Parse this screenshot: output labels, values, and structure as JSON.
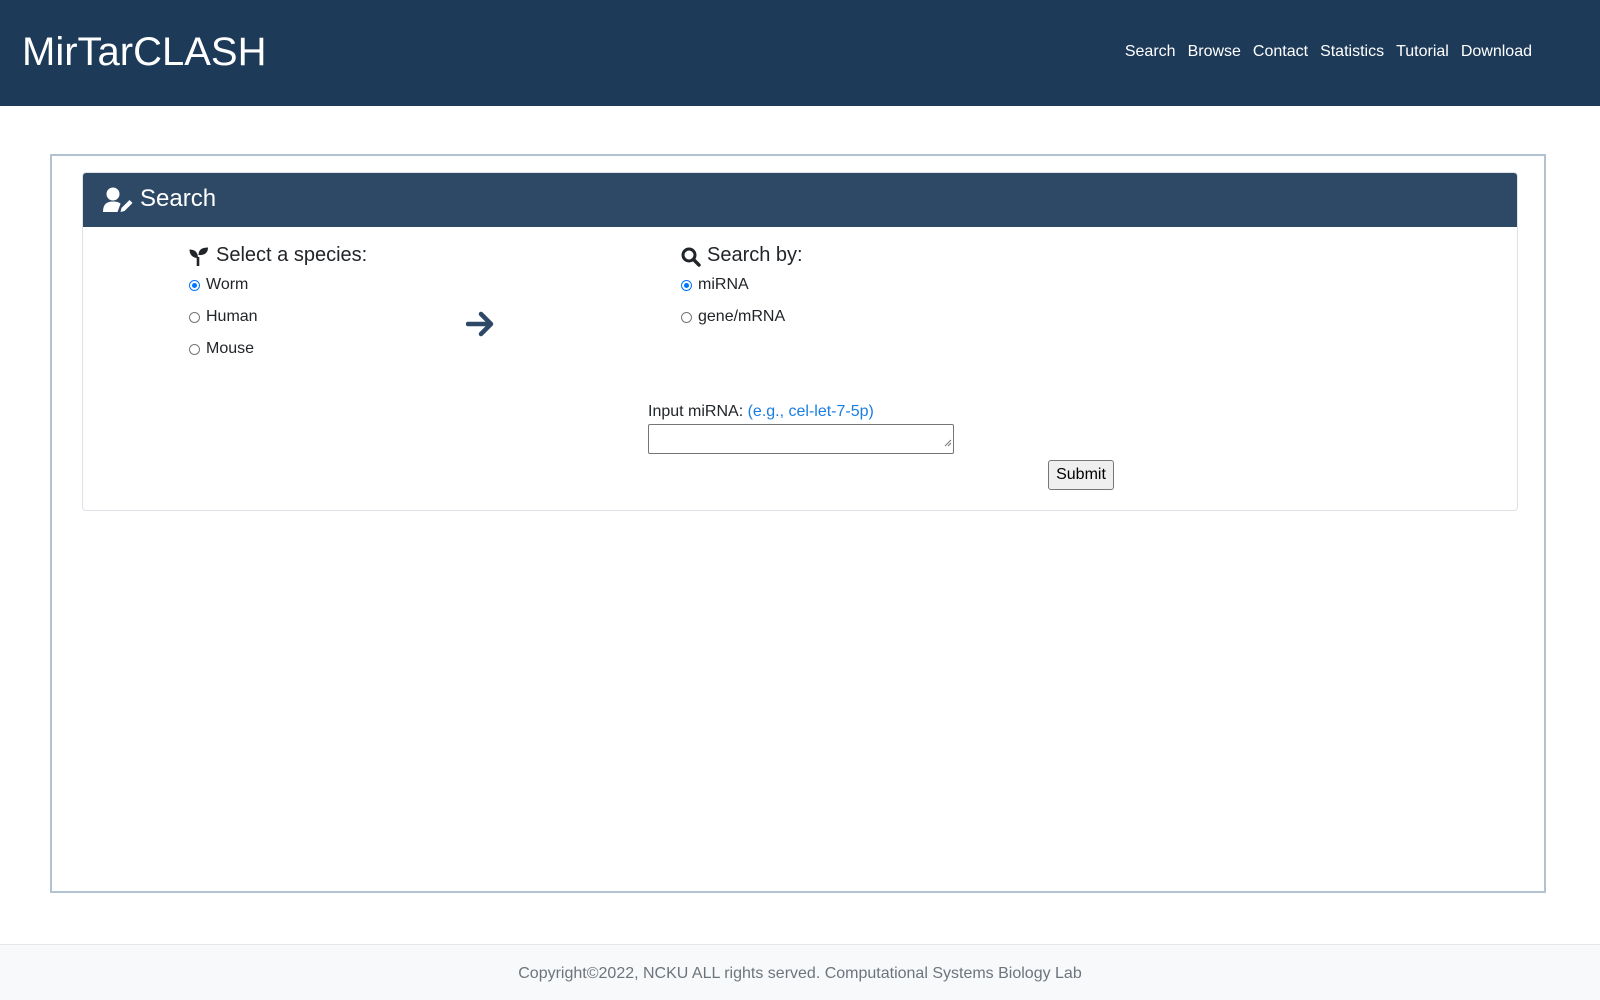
{
  "header": {
    "brand": "MirTarCLASH",
    "nav": [
      "Search",
      "Browse",
      "Contact",
      "Statistics",
      "Tutorial",
      "Download"
    ]
  },
  "card": {
    "title": "Search",
    "title_icon": "user-edit-icon"
  },
  "species": {
    "title": "Select a species:",
    "icon": "seedling-icon",
    "options": [
      "Worm",
      "Human",
      "Mouse"
    ],
    "selected": "Worm"
  },
  "search_by": {
    "title": "Search by:",
    "icon": "magnifier-icon",
    "options": [
      "miRNA",
      "gene/mRNA"
    ],
    "selected": "miRNA"
  },
  "arrow_icon": "arrow-right-icon",
  "input": {
    "label": "Input miRNA:",
    "hint": "(e.g., cel-let-7-5p)",
    "value": ""
  },
  "submit_label": "Submit",
  "footer": {
    "text": "Copyright©2022, NCKU ALL rights served. Computational Systems Biology Lab"
  },
  "colors": {
    "header_bg": "#1d3a58",
    "card_header_bg": "#2e4966",
    "accent_blue": "#0075ff",
    "hint_link": "#1a7de4"
  }
}
